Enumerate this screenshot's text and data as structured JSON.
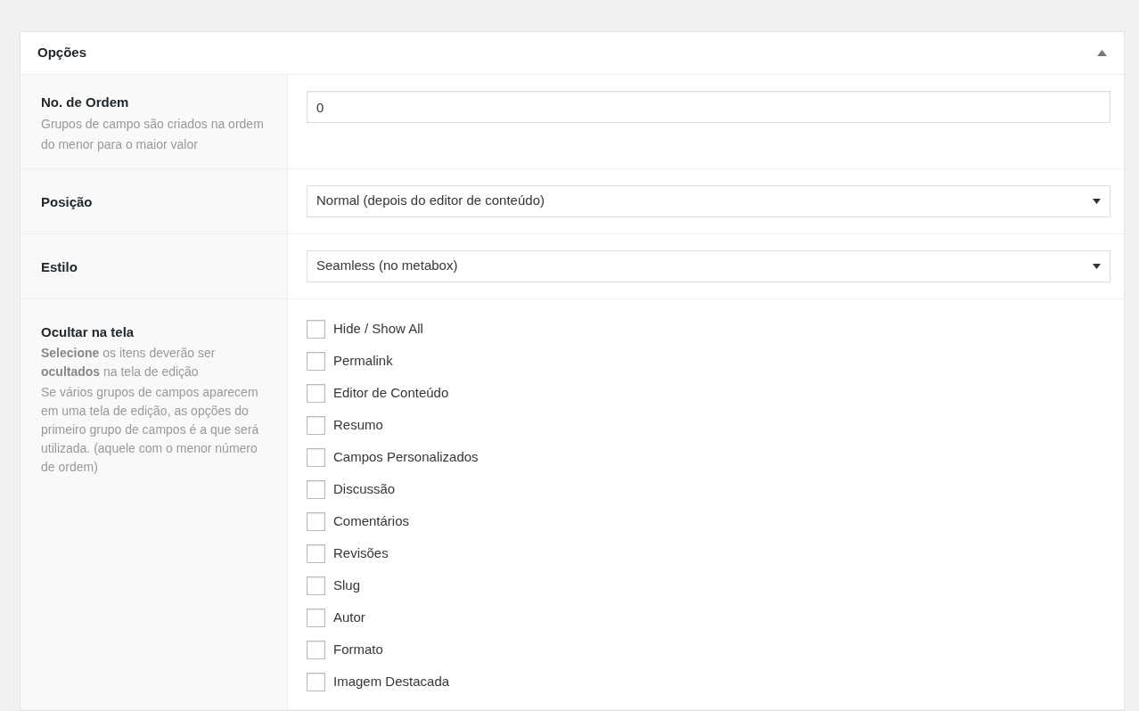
{
  "panel": {
    "title": "Opções",
    "expanded": true
  },
  "rows": [
    {
      "kind": "text",
      "label": "No. de Ordem",
      "description": [
        "Grupos de campo são criados na ordem",
        "do menor para o maior valor"
      ],
      "value": "0"
    },
    {
      "kind": "select",
      "label": "Posição",
      "value": "Normal (depois do editor de conteúdo)"
    },
    {
      "kind": "select",
      "label": "Estilo",
      "value": "Seamless (no metabox)"
    },
    {
      "kind": "checklist",
      "label": "Ocultar na tela",
      "description": [
        "**Selecione** os itens deverão ser **ocultados** na tela de edição",
        "Se vários grupos de campos aparecem em uma tela de edição, as opções do primeiro grupo de campos é a que será utilizada. (aquele com o menor número de ordem)"
      ],
      "options": [
        {
          "label": "Hide / Show All",
          "checked": false
        },
        {
          "label": "Permalink",
          "checked": false
        },
        {
          "label": "Editor de Conteúdo",
          "checked": false
        },
        {
          "label": "Resumo",
          "checked": false
        },
        {
          "label": "Campos Personalizados",
          "checked": false
        },
        {
          "label": "Discussão",
          "checked": false
        },
        {
          "label": "Comentários",
          "checked": false
        },
        {
          "label": "Revisões",
          "checked": false
        },
        {
          "label": "Slug",
          "checked": false
        },
        {
          "label": "Autor",
          "checked": false
        },
        {
          "label": "Formato",
          "checked": false
        },
        {
          "label": "Imagem Destacada",
          "checked": false
        }
      ]
    }
  ]
}
